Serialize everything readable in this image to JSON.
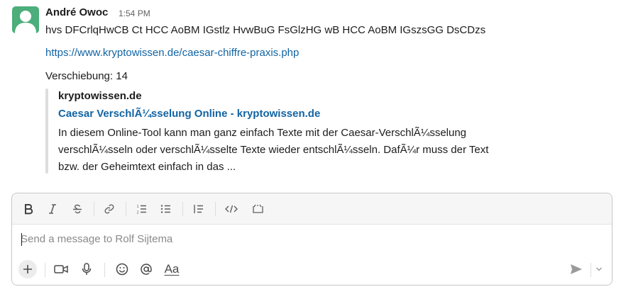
{
  "message": {
    "sender": "André Owoc",
    "time": "1:54 PM",
    "text": "hvs DFCrlqHwCB Ct HCC AoBM IGstlz HvwBuG FsGlzHG wB HCC AoBM IGszsGG DsCDzs",
    "link": "https://www.kryptowissen.de/caesar-chiffre-praxis.php",
    "shift": "Verschiebung: 14"
  },
  "unfurl": {
    "site": "kryptowissen.de",
    "title": "Caesar VerschlÃ¼sselung Online - kryptowissen.de",
    "description": "In diesem Online-Tool kann man ganz einfach Texte mit der Caesar-VerschlÃ¼sselung verschlÃ¼sseln oder verschlÃ¼sselte Texte wieder entschlÃ¼sseln. DafÃ¼r muss der Text bzw. der Geheimtext einfach in das ..."
  },
  "composer": {
    "placeholder": "Send a message to Rolf Sijtema",
    "value": "",
    "format_label": "Aa"
  },
  "colors": {
    "link": "#1264a3",
    "avatar": "#4cae7a",
    "text": "#1d1c1d",
    "muted": "#616061"
  }
}
